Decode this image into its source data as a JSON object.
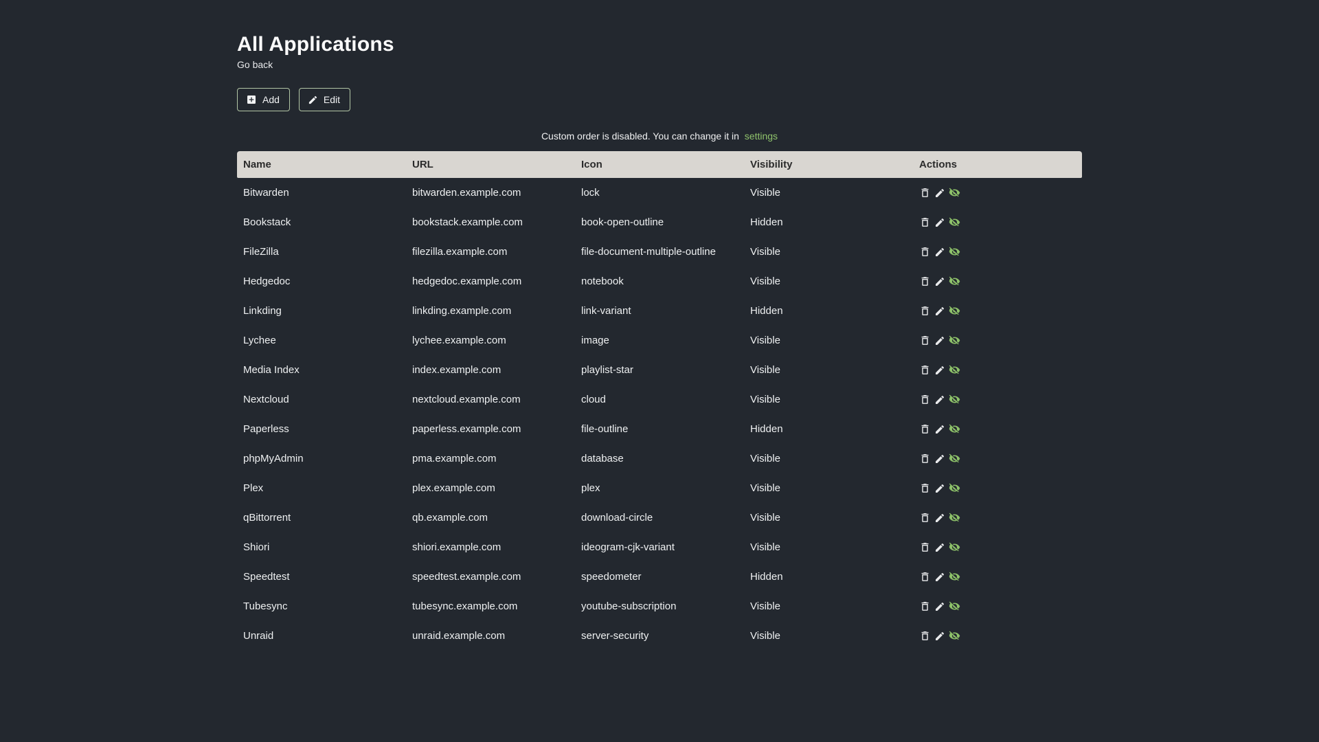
{
  "page": {
    "title": "All Applications",
    "back_link": "Go back",
    "notice_text": "Custom order is disabled. You can change it in",
    "notice_link": "settings"
  },
  "toolbar": {
    "add_label": "Add",
    "edit_label": "Edit"
  },
  "colors": {
    "background": "#23282f",
    "accent_green": "#90c46c",
    "table_header_bg": "#d9d6d1",
    "button_border": "#b3c7a6"
  },
  "icons": {
    "add_button": "plus-box-icon",
    "edit_button": "pencil-icon",
    "row_actions": [
      "trash-icon",
      "pencil-icon",
      "eye-off-icon"
    ]
  },
  "table": {
    "headers": [
      "Name",
      "URL",
      "Icon",
      "Visibility",
      "Actions"
    ],
    "rows": [
      {
        "name": "Bitwarden",
        "url": "bitwarden.example.com",
        "icon": "lock",
        "visibility": "Visible"
      },
      {
        "name": "Bookstack",
        "url": "bookstack.example.com",
        "icon": "book-open-outline",
        "visibility": "Hidden"
      },
      {
        "name": "FileZilla",
        "url": "filezilla.example.com",
        "icon": "file-document-multiple-outline",
        "visibility": "Visible"
      },
      {
        "name": "Hedgedoc",
        "url": "hedgedoc.example.com",
        "icon": "notebook",
        "visibility": "Visible"
      },
      {
        "name": "Linkding",
        "url": "linkding.example.com",
        "icon": "link-variant",
        "visibility": "Hidden"
      },
      {
        "name": "Lychee",
        "url": "lychee.example.com",
        "icon": "image",
        "visibility": "Visible"
      },
      {
        "name": "Media Index",
        "url": "index.example.com",
        "icon": "playlist-star",
        "visibility": "Visible"
      },
      {
        "name": "Nextcloud",
        "url": "nextcloud.example.com",
        "icon": "cloud",
        "visibility": "Visible"
      },
      {
        "name": "Paperless",
        "url": "paperless.example.com",
        "icon": "file-outline",
        "visibility": "Hidden"
      },
      {
        "name": "phpMyAdmin",
        "url": "pma.example.com",
        "icon": "database",
        "visibility": "Visible"
      },
      {
        "name": "Plex",
        "url": "plex.example.com",
        "icon": "plex",
        "visibility": "Visible"
      },
      {
        "name": "qBittorrent",
        "url": "qb.example.com",
        "icon": "download-circle",
        "visibility": "Visible"
      },
      {
        "name": "Shiori",
        "url": "shiori.example.com",
        "icon": "ideogram-cjk-variant",
        "visibility": "Visible"
      },
      {
        "name": "Speedtest",
        "url": "speedtest.example.com",
        "icon": "speedometer",
        "visibility": "Hidden"
      },
      {
        "name": "Tubesync",
        "url": "tubesync.example.com",
        "icon": "youtube-subscription",
        "visibility": "Visible"
      },
      {
        "name": "Unraid",
        "url": "unraid.example.com",
        "icon": "server-security",
        "visibility": "Visible"
      }
    ]
  }
}
